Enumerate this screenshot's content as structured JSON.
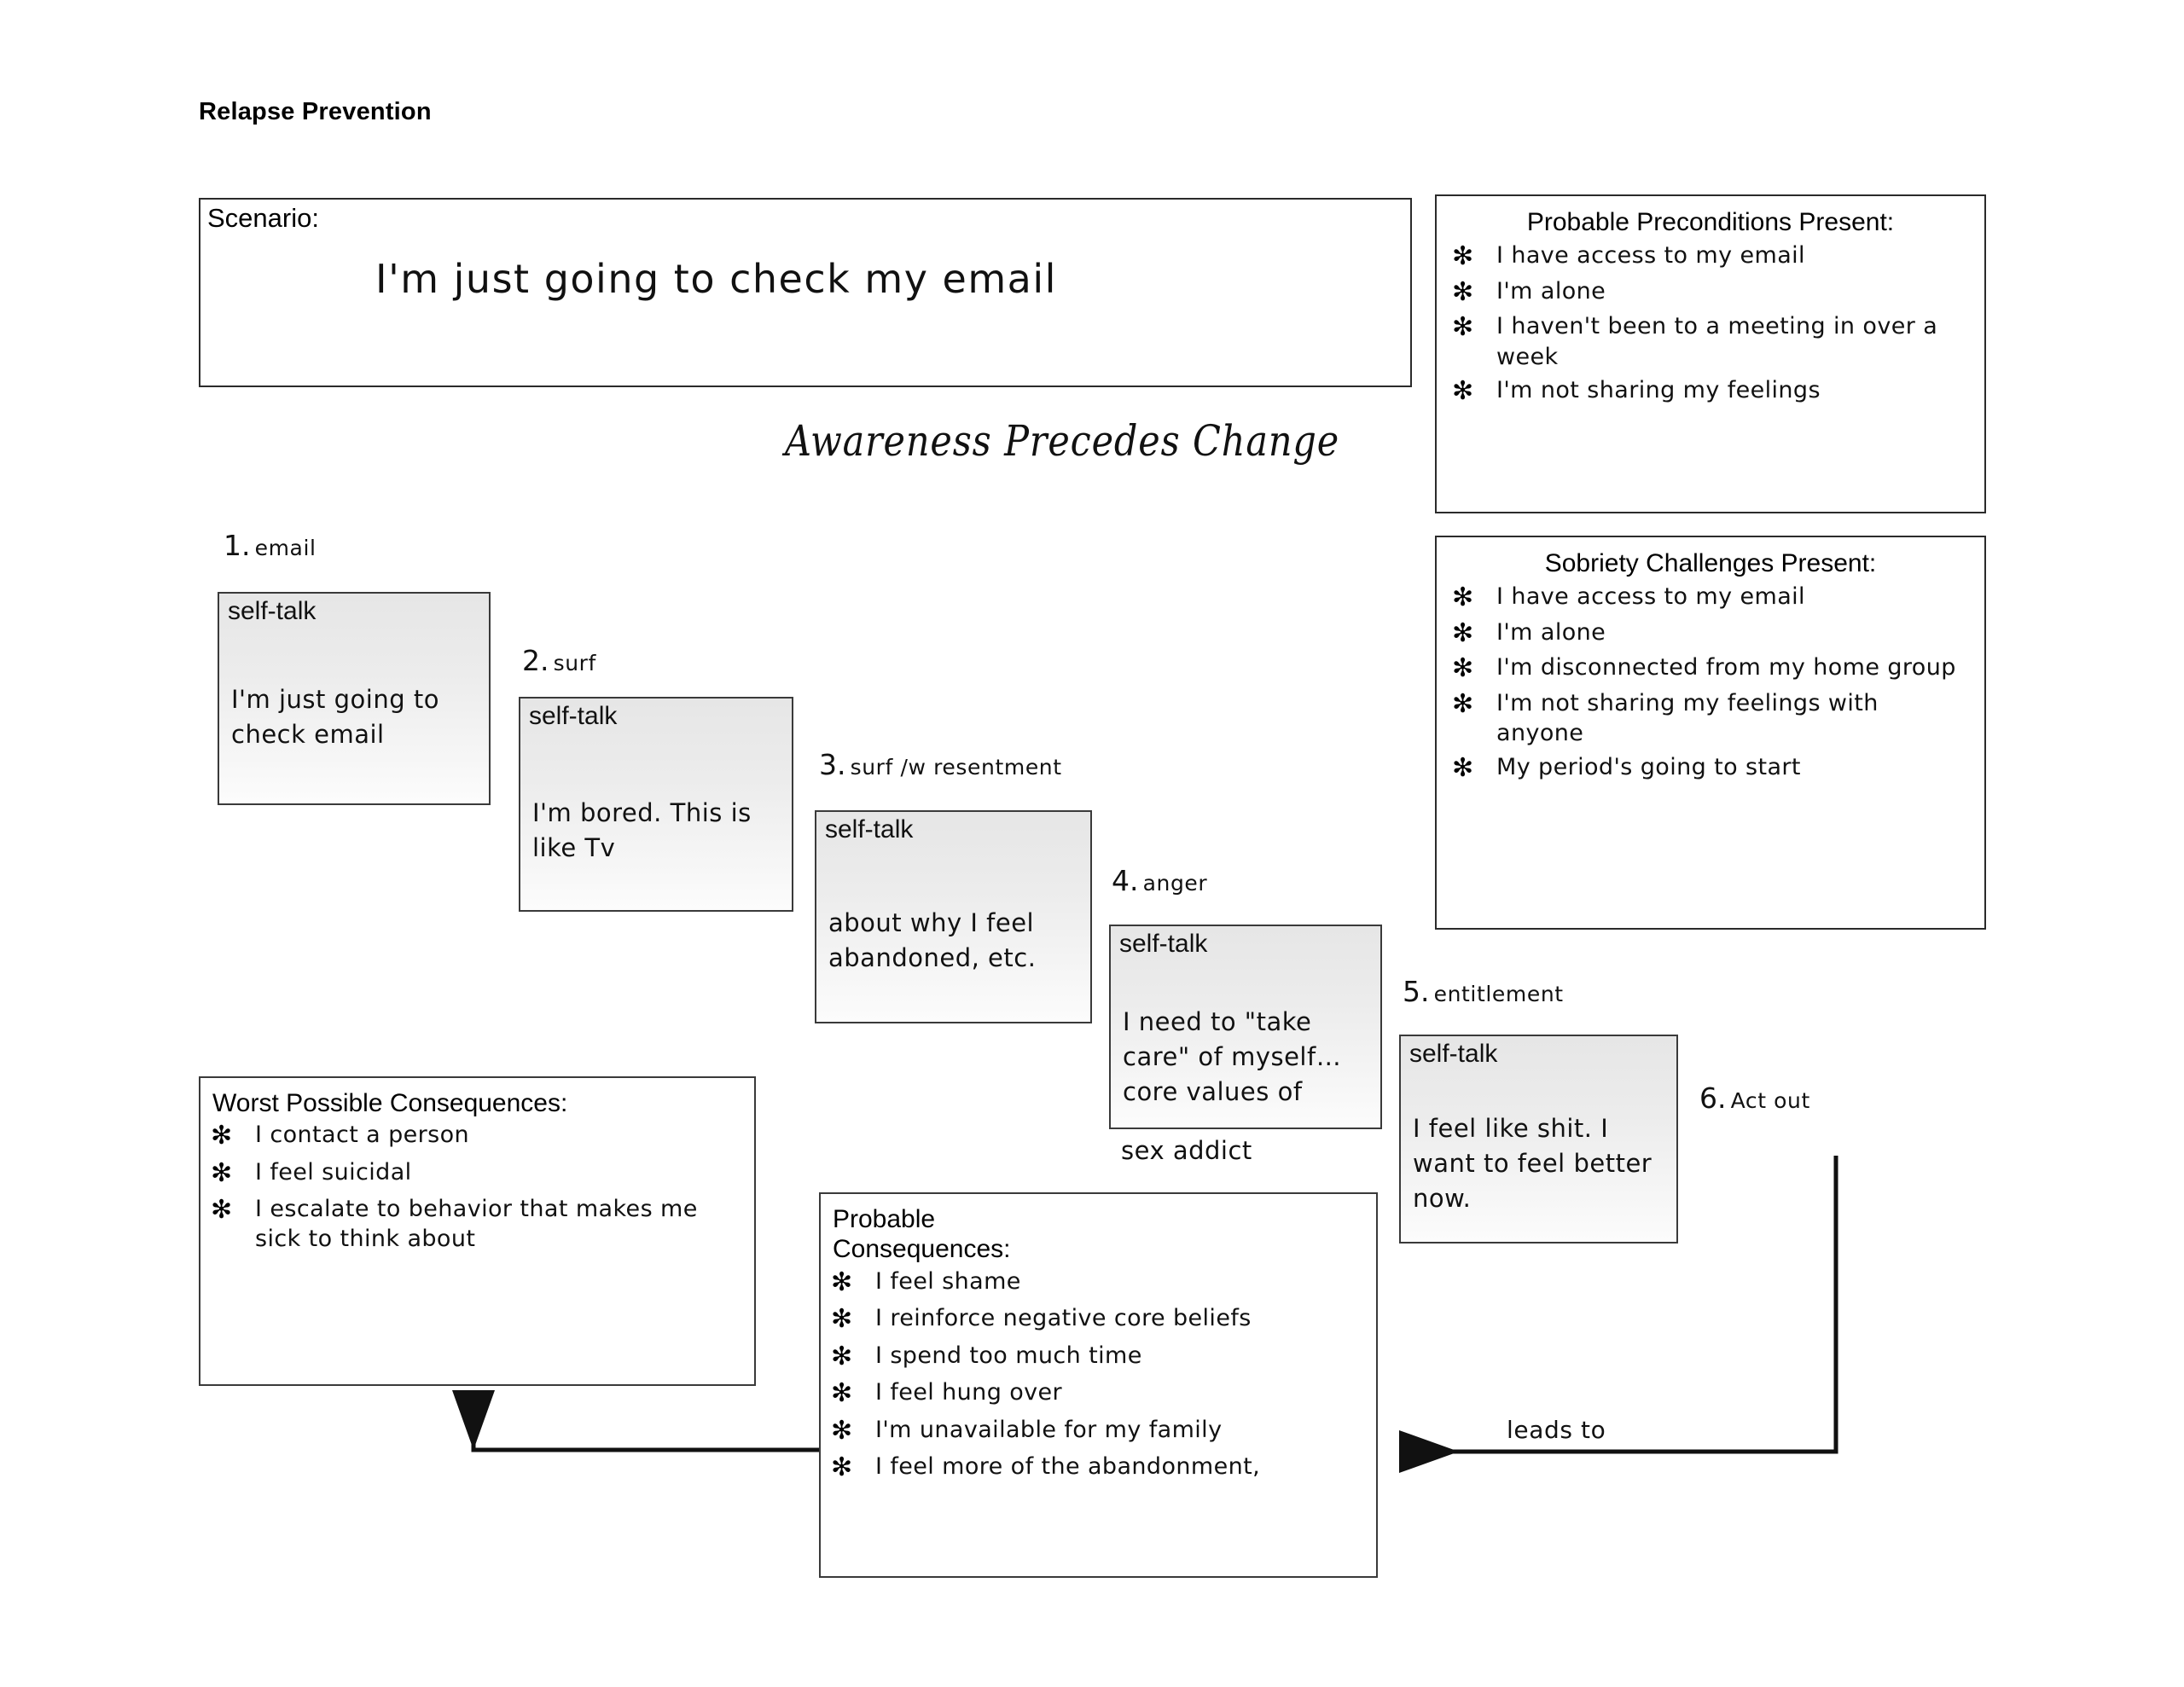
{
  "page": {
    "title": "Relapse Prevention",
    "tagline": "Awareness Precedes Change"
  },
  "scenario": {
    "label": "Scenario:",
    "text": "I'm just going to check my email"
  },
  "preconditions": {
    "title": "Probable Preconditions Present:",
    "bullet": "✻",
    "items": [
      "I have access to my email",
      "I'm alone",
      "I haven't been to a meeting in over a week",
      "I'm not sharing my feelings"
    ]
  },
  "sobriety": {
    "title": "Sobriety Challenges Present:",
    "bullet": "✻",
    "items": [
      "I have access to my email",
      "I'm alone",
      "I'm disconnected from my home group",
      "I'm not sharing my feelings with anyone",
      "My period's going to start"
    ]
  },
  "steps": [
    {
      "number": "1.",
      "name": "email",
      "note_header": "self-talk",
      "note_text": "I'm just going to check email",
      "overflow_text": ""
    },
    {
      "number": "2.",
      "name": "surf",
      "note_header": "self-talk",
      "note_text": "I'm bored. This is like Tv",
      "overflow_text": ""
    },
    {
      "number": "3.",
      "name": "surf /w resentment",
      "note_header": "self-talk",
      "note_text": "about why I feel abandoned, etc.",
      "overflow_text": ""
    },
    {
      "number": "4.",
      "name": "anger",
      "note_header": "self-talk",
      "note_text": "I need to \"take care\" of myself… core values of",
      "overflow_text": "sex addict"
    },
    {
      "number": "5.",
      "name": "entitlement",
      "note_header": "self-talk",
      "note_text": "I feel like shit. I want to feel better now.",
      "overflow_text": ""
    },
    {
      "number": "6.",
      "name": "Act out",
      "note_header": "",
      "note_text": "",
      "overflow_text": ""
    }
  ],
  "worst_consequences": {
    "title": "Worst Possible Consequences:",
    "bullet": "✻",
    "items": [
      "I contact a person",
      "I feel suicidal",
      "I escalate to behavior that makes me sick to think about"
    ]
  },
  "probable_consequences": {
    "title_line1": "Probable",
    "title_line2": "Consequences:",
    "bullet": "✻",
    "items": [
      "I feel shame",
      "I reinforce negative core beliefs",
      "I spend too much time",
      "I feel hung over",
      "I'm unavailable for my family",
      "I feel more of the abandonment,"
    ]
  },
  "connectors": {
    "leads_to_label": "leads to"
  },
  "colors": {
    "ink": "#111111",
    "border": "#2b2b2b",
    "note_top": "#e6e6e6",
    "note_bottom": "#fcfcfc",
    "page_background": "#ffffff"
  }
}
